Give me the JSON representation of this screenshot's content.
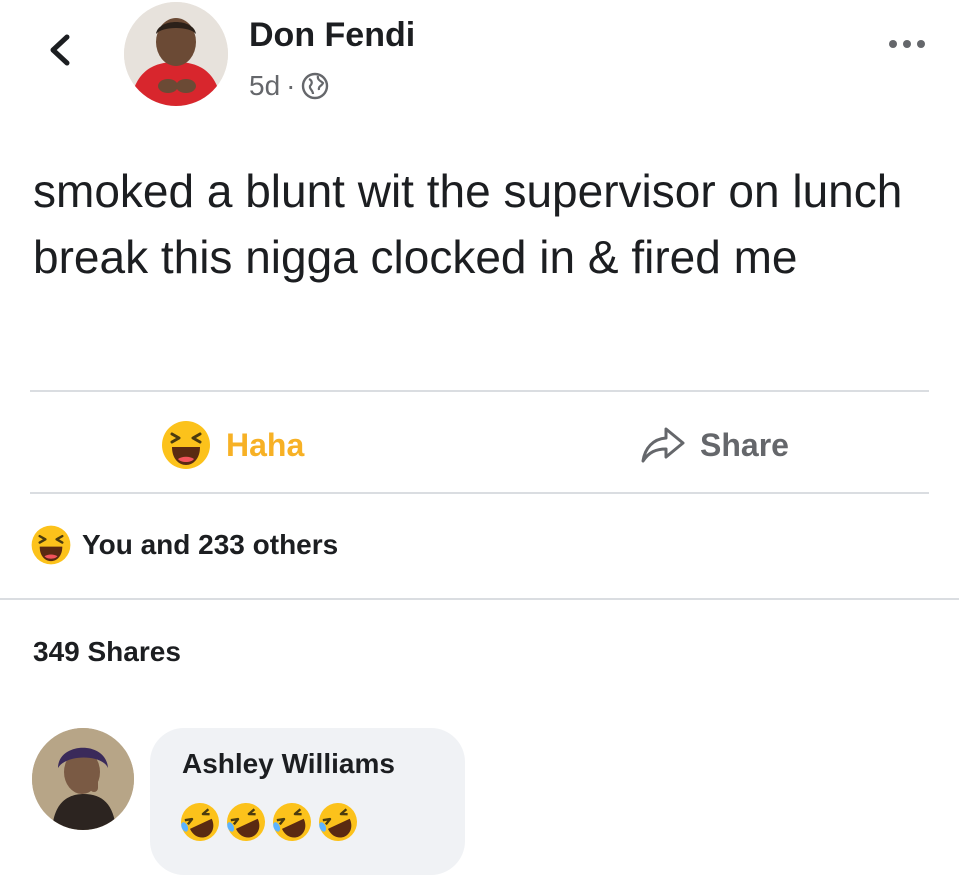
{
  "header": {
    "author_name": "Don Fendi",
    "timestamp": "5d",
    "separator": "·",
    "privacy_icon": "globe-icon",
    "back_icon": "chevron-left-icon",
    "more_icon": "more-horizontal-icon"
  },
  "post": {
    "text": "smoked a blunt wit the supervisor on lunch break this nigga clocked in & fired me"
  },
  "actions": {
    "reaction_label": "Haha",
    "reaction_icon": "haha-emoji-icon",
    "share_label": "Share",
    "share_icon": "share-arrow-icon"
  },
  "engagement": {
    "reactions_text": "You and 233 others",
    "shares_text": "349 Shares"
  },
  "comment": {
    "author": "Ashley Williams",
    "emoji_icon": "rofl-emoji-icon",
    "emoji_count": 4
  },
  "colors": {
    "haha_yellow": "#f7b125",
    "secondary_text": "#65676b",
    "bubble_bg": "#f0f2f5"
  }
}
